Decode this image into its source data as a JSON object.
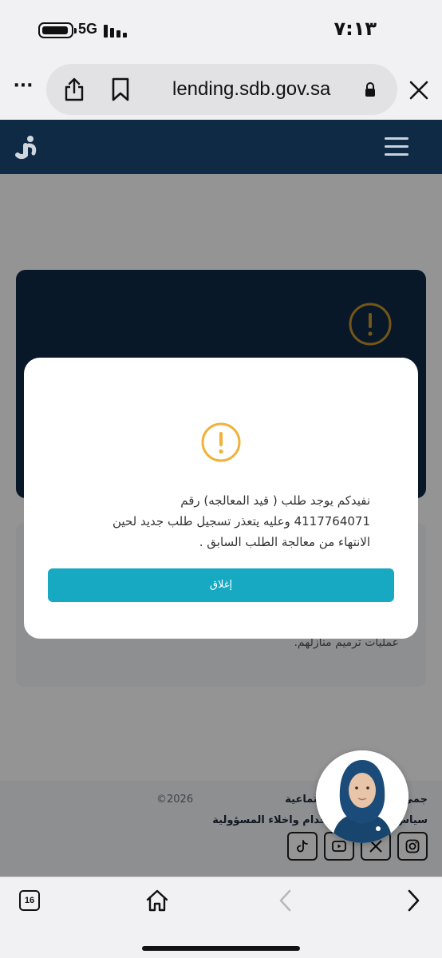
{
  "status_bar": {
    "time": "٧:١٣",
    "network": "5G"
  },
  "browser": {
    "url": "lending.sdb.gov.sa",
    "more_label": "···",
    "tab_count": "16"
  },
  "page": {
    "info_text": "عمليات ترميم منازلهم.",
    "footer": {
      "line1": "جمي              لبنك التنمية الاجتماعية",
      "copyright": "©2026",
      "line2": "سياس          سياسة الاستخدام واخلاء المسؤولية",
      "social_icons": [
        "tiktok-icon",
        "youtube-icon",
        "x-icon",
        "instagram-icon"
      ]
    }
  },
  "modal": {
    "message_lines": [
      "نفيدكم يوجد طلب ( قيد المعالجه) رقم",
      "4117764071 وعليه يتعذر تسجيل طلب جديد لحين",
      "الانتهاء من معالجة الطلب السابق ."
    ],
    "close_label": "إغلاق"
  },
  "colors": {
    "header_bg": "#0f2a45",
    "accent_teal": "#17a8c2",
    "warning_yellow": "#f0b23a",
    "warning_dark": "#c9962a"
  }
}
